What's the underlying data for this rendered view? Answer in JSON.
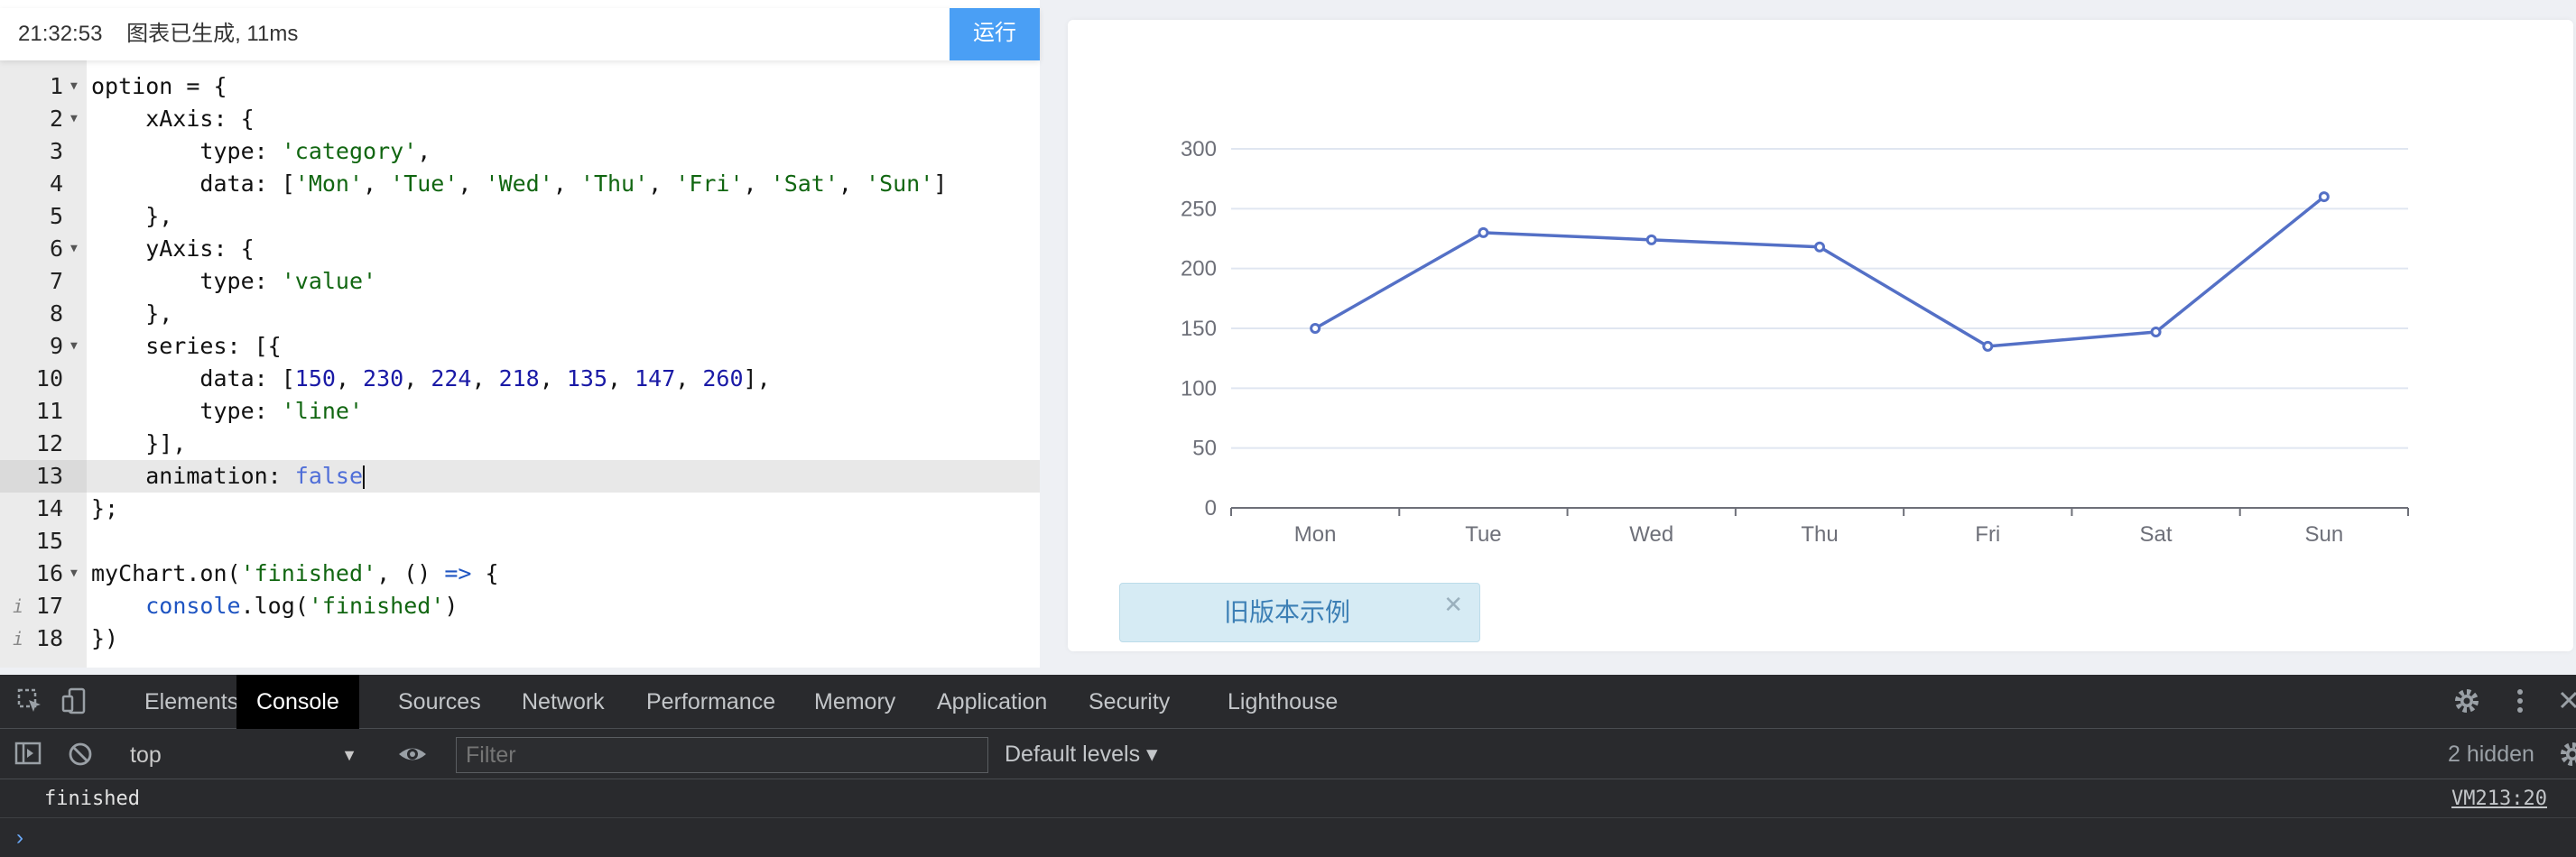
{
  "status": {
    "time": "21:32:53",
    "message": "图表已生成, 11ms"
  },
  "run_button": "运行",
  "editor": {
    "active_line": 13,
    "lines": [
      {
        "n": "1",
        "fold": true,
        "info": false,
        "tokens": [
          [
            "p",
            "option = {"
          ]
        ]
      },
      {
        "n": "2",
        "fold": true,
        "info": false,
        "tokens": [
          [
            "p",
            "    xAxis: {"
          ]
        ]
      },
      {
        "n": "3",
        "fold": false,
        "info": false,
        "tokens": [
          [
            "p",
            "        type: "
          ],
          [
            "s",
            "'category'"
          ],
          [
            "p",
            ","
          ]
        ]
      },
      {
        "n": "4",
        "fold": false,
        "info": false,
        "tokens": [
          [
            "p",
            "        data: ["
          ],
          [
            "s",
            "'Mon'"
          ],
          [
            "p",
            ", "
          ],
          [
            "s",
            "'Tue'"
          ],
          [
            "p",
            ", "
          ],
          [
            "s",
            "'Wed'"
          ],
          [
            "p",
            ", "
          ],
          [
            "s",
            "'Thu'"
          ],
          [
            "p",
            ", "
          ],
          [
            "s",
            "'Fri'"
          ],
          [
            "p",
            ", "
          ],
          [
            "s",
            "'Sat'"
          ],
          [
            "p",
            ", "
          ],
          [
            "s",
            "'Sun'"
          ],
          [
            "p",
            "]"
          ]
        ]
      },
      {
        "n": "5",
        "fold": false,
        "info": false,
        "tokens": [
          [
            "p",
            "    },"
          ]
        ]
      },
      {
        "n": "6",
        "fold": true,
        "info": false,
        "tokens": [
          [
            "p",
            "    yAxis: {"
          ]
        ]
      },
      {
        "n": "7",
        "fold": false,
        "info": false,
        "tokens": [
          [
            "p",
            "        type: "
          ],
          [
            "s",
            "'value'"
          ]
        ]
      },
      {
        "n": "8",
        "fold": false,
        "info": false,
        "tokens": [
          [
            "p",
            "    },"
          ]
        ]
      },
      {
        "n": "9",
        "fold": true,
        "info": false,
        "tokens": [
          [
            "p",
            "    series: [{"
          ]
        ]
      },
      {
        "n": "10",
        "fold": false,
        "info": false,
        "tokens": [
          [
            "p",
            "        data: ["
          ],
          [
            "n",
            "150"
          ],
          [
            "p",
            ", "
          ],
          [
            "n",
            "230"
          ],
          [
            "p",
            ", "
          ],
          [
            "n",
            "224"
          ],
          [
            "p",
            ", "
          ],
          [
            "n",
            "218"
          ],
          [
            "p",
            ", "
          ],
          [
            "n",
            "135"
          ],
          [
            "p",
            ", "
          ],
          [
            "n",
            "147"
          ],
          [
            "p",
            ", "
          ],
          [
            "n",
            "260"
          ],
          [
            "p",
            "],"
          ]
        ]
      },
      {
        "n": "11",
        "fold": false,
        "info": false,
        "tokens": [
          [
            "p",
            "        type: "
          ],
          [
            "s",
            "'line'"
          ]
        ]
      },
      {
        "n": "12",
        "fold": false,
        "info": false,
        "tokens": [
          [
            "p",
            "    }],"
          ]
        ]
      },
      {
        "n": "13",
        "fold": false,
        "info": false,
        "tokens": [
          [
            "p",
            "    animation: "
          ],
          [
            "b",
            "false"
          ]
        ]
      },
      {
        "n": "14",
        "fold": false,
        "info": false,
        "tokens": [
          [
            "p",
            "};"
          ]
        ]
      },
      {
        "n": "15",
        "fold": false,
        "info": false,
        "tokens": [
          [
            "p",
            ""
          ]
        ]
      },
      {
        "n": "16",
        "fold": true,
        "info": false,
        "tokens": [
          [
            "p",
            "myChart.on("
          ],
          [
            "s",
            "'finished'"
          ],
          [
            "p",
            ", () "
          ],
          [
            "f",
            "=>"
          ],
          [
            "p",
            " {"
          ]
        ]
      },
      {
        "n": "17",
        "fold": false,
        "info": true,
        "tokens": [
          [
            "p",
            "    "
          ],
          [
            "f",
            "console"
          ],
          [
            "p",
            ".log("
          ],
          [
            "s",
            "'finished'"
          ],
          [
            "p",
            ")"
          ]
        ]
      },
      {
        "n": "18",
        "fold": false,
        "info": true,
        "tokens": [
          [
            "p",
            "})"
          ]
        ]
      }
    ]
  },
  "chart_data": {
    "type": "line",
    "categories": [
      "Mon",
      "Tue",
      "Wed",
      "Thu",
      "Fri",
      "Sat",
      "Sun"
    ],
    "series": [
      {
        "values": [
          150,
          230,
          224,
          218,
          135,
          147,
          260
        ]
      }
    ],
    "ylim": [
      0,
      300
    ],
    "yticks": [
      0,
      50,
      100,
      150,
      200,
      250,
      300
    ],
    "title": "",
    "xlabel": "",
    "ylabel": "",
    "grid": true,
    "line_color": "#5470c6"
  },
  "legacy_badge": {
    "text": "旧版本示例",
    "close": "✕"
  },
  "devtools": {
    "tabs": [
      "Elements",
      "Console",
      "Sources",
      "Network",
      "Performance",
      "Memory",
      "Application",
      "Security",
      "Lighthouse"
    ],
    "selected_tab": "Console",
    "context": "top",
    "filter_placeholder": "Filter",
    "levels": "Default levels ▾",
    "hidden": "2 hidden",
    "messages": [
      {
        "text": "finished",
        "source": "VM213:20"
      }
    ],
    "prompt": "›"
  }
}
